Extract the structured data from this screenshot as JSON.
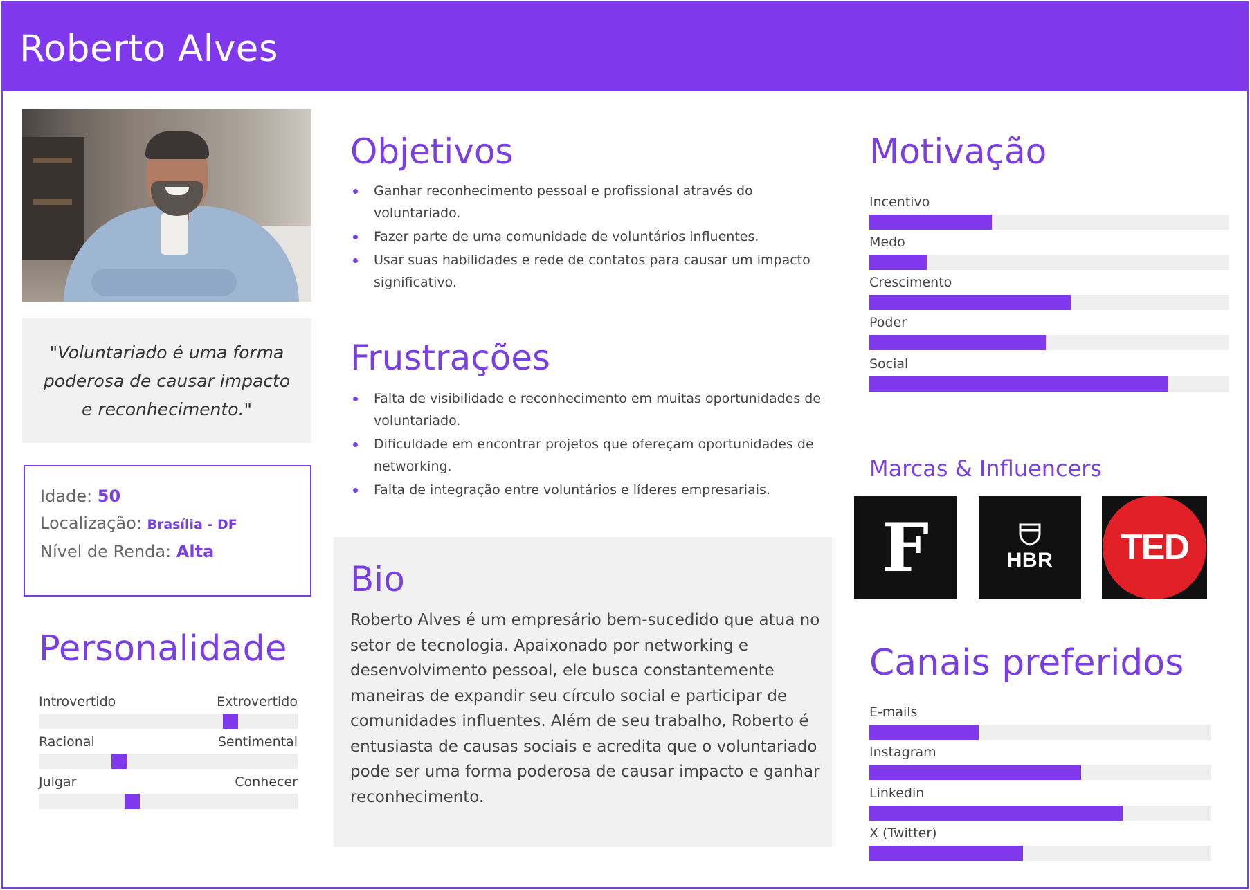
{
  "header": {
    "name": "Roberto Alves"
  },
  "quote": "\"Voluntariado é uma forma poderosa de causar impacto e reconhecimento.\"",
  "info": {
    "age_label": "Idade:",
    "age_value": "50",
    "location_label": "Localização:",
    "location_value": "Brasília - DF",
    "income_label": "Nível de Renda:",
    "income_value": "Alta"
  },
  "personality": {
    "title": "Personalidade",
    "traits": [
      {
        "left": "Introvertido",
        "right": "Extrovertido",
        "value": 0.74
      },
      {
        "left": "Racional",
        "right": "Sentimental",
        "value": 0.31
      },
      {
        "left": "Julgar",
        "right": "Conhecer",
        "value": 0.36
      }
    ]
  },
  "goals": {
    "title": "Objetivos",
    "items": [
      "Ganhar reconhecimento pessoal e profissional através do voluntariado.",
      "Fazer parte de uma comunidade de voluntários influentes.",
      "Usar suas habilidades e rede de contatos para causar um impacto significativo."
    ]
  },
  "frustrations": {
    "title": "Frustrações",
    "items": [
      "Falta de visibilidade e reconhecimento em muitas oportunidades de voluntariado.",
      "Dificuldade em encontrar projetos que ofereçam oportunidades de networking.",
      "Falta de integração entre voluntários e líderes empresariais."
    ]
  },
  "bio": {
    "title": "Bio",
    "text": "Roberto Alves é um empresário bem-sucedido que atua no setor de tecnologia. Apaixonado por networking e desenvolvimento pessoal, ele busca constantemente maneiras de expandir seu círculo social e participar de comunidades influentes. Além de seu trabalho, Roberto é entusiasta de causas sociais e acredita que o voluntariado pode ser uma forma poderosa de causar impacto e ganhar reconhecimento."
  },
  "motivation": {
    "title": "Motivação",
    "items": [
      {
        "label": "Incentivo",
        "value": 0.34
      },
      {
        "label": "Medo",
        "value": 0.16
      },
      {
        "label": "Crescimento",
        "value": 0.56
      },
      {
        "label": "Poder",
        "value": 0.49
      },
      {
        "label": "Social",
        "value": 0.83
      }
    ]
  },
  "brands": {
    "title": "Marcas & Influencers",
    "logos": [
      {
        "name": "forbes-logo",
        "text": "F"
      },
      {
        "name": "hbr-logo",
        "text": "HBR"
      },
      {
        "name": "ted-logo",
        "text": "TED"
      }
    ]
  },
  "channels": {
    "title": "Canais preferidos",
    "items": [
      {
        "label": "E-mails",
        "value": 0.32
      },
      {
        "label": "Instagram",
        "value": 0.62
      },
      {
        "label": "Linkedin",
        "value": 0.74
      },
      {
        "label": "X (Twitter)",
        "value": 0.45
      }
    ]
  },
  "colors": {
    "accent": "#7f38ec",
    "panel": "#f1f1f2",
    "track": "#efeff0"
  }
}
